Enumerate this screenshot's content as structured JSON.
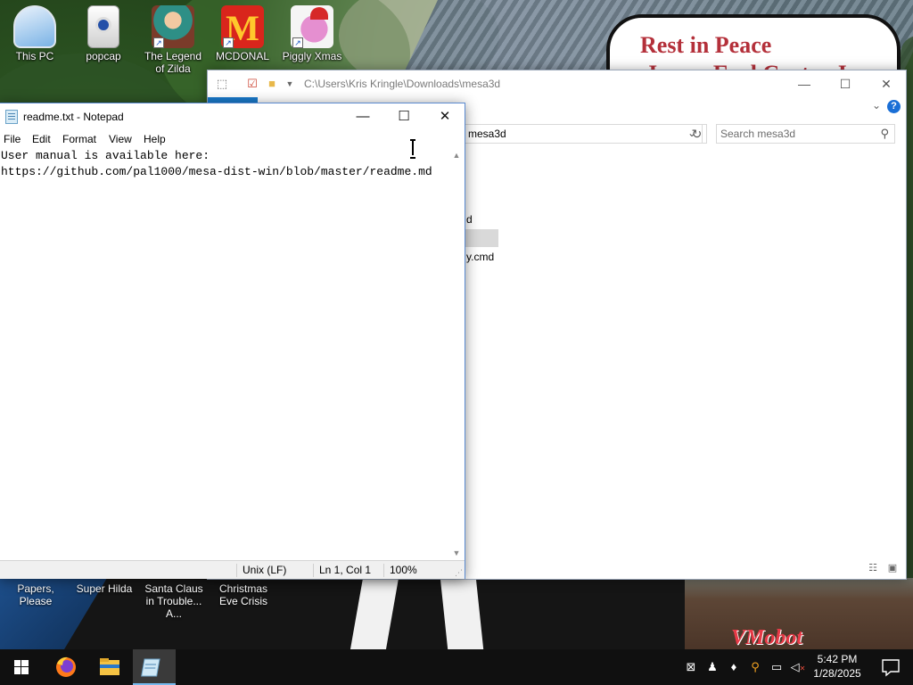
{
  "desktop": {
    "icons": [
      {
        "label": "This PC",
        "icon": "monitor-icon"
      },
      {
        "label": "popcap",
        "icon": "popcap-icon"
      },
      {
        "label": "The Legend of Zilda",
        "icon": "zelda-game-icon"
      },
      {
        "label": "MCDONAL",
        "icon": "mcdonalds-logo-icon"
      },
      {
        "label": "Piggly Xmas",
        "icon": "pig-santa-icon"
      }
    ],
    "lower_labels": [
      "Papers, Please",
      "Super Hilda",
      "Santa Claus in Trouble... A...",
      "Christmas Eve Crisis"
    ],
    "wallpaper_sign": {
      "line1": "Rest in Peace",
      "line2": "James Earl Carter Jr."
    },
    "watermark": "VMobot"
  },
  "explorer": {
    "title_path": "C:\\Users\\Kris Kringle\\Downloads\\mesa3d",
    "address": "mesa3d",
    "search_placeholder": "Search mesa3d",
    "visible_items": [
      "d",
      "",
      "y.cmd"
    ],
    "colors": {
      "file_tab": "#1979ca"
    }
  },
  "notepad": {
    "title": "readme.txt - Notepad",
    "menu": [
      "File",
      "Edit",
      "Format",
      "View",
      "Help"
    ],
    "content_line1": "User manual is available here:",
    "content_line2": "https://github.com/pal1000/mesa-dist-win/blob/master/readme.md",
    "status": {
      "line_ending": "Unix (LF)",
      "position": "Ln 1, Col 1",
      "zoom": "100%"
    }
  },
  "taskbar": {
    "pinned": [
      {
        "icon": "windows-start-icon"
      },
      {
        "icon": "firefox-icon"
      },
      {
        "icon": "file-explorer-icon"
      },
      {
        "icon": "notepad-icon",
        "active": true
      }
    ],
    "tray_icons": [
      "security-icon",
      "people-icon",
      "drop-icon",
      "search-tool-icon",
      "network-icon",
      "volume-muted-icon"
    ],
    "time": "5:42 PM",
    "date": "1/28/2025"
  }
}
